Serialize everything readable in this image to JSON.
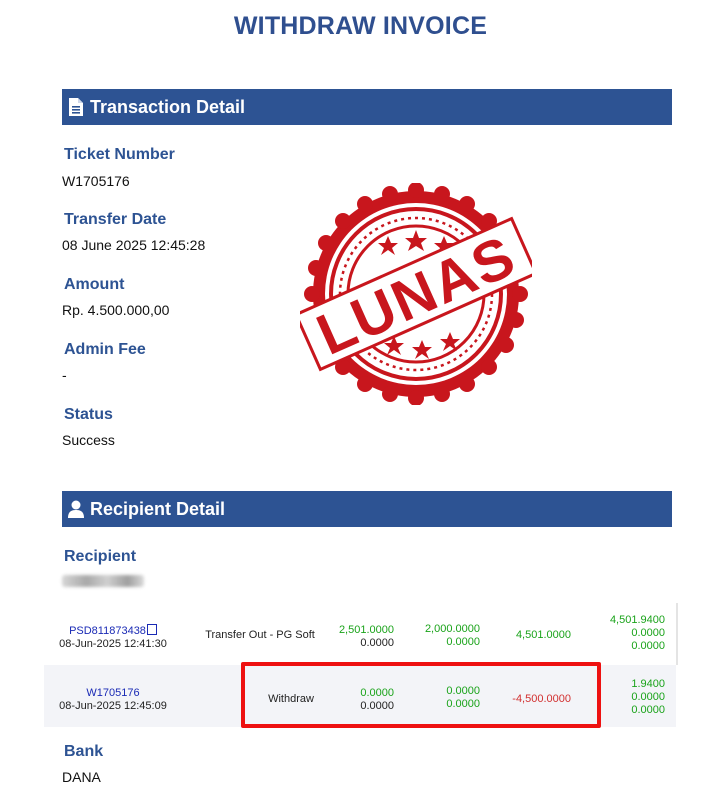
{
  "title": "WITHDRAW INVOICE",
  "transaction": {
    "heading": "Transaction Detail",
    "ticket_label": "Ticket Number",
    "ticket_value": "W1705176",
    "date_label": "Transfer Date",
    "date_value": "08 June 2025 12:45:28",
    "amount_label": "Amount",
    "amount_value": "Rp. 4.500.000,00",
    "fee_label": "Admin Fee",
    "fee_value": "-",
    "status_label": "Status",
    "status_value": "Success"
  },
  "stamp": {
    "text": "LUNAS",
    "color": "#c8161d"
  },
  "recipient": {
    "heading": "Recipient Detail",
    "label": "Recipient",
    "bank_label": "Bank",
    "bank_value": "DANA"
  },
  "table_rows": [
    {
      "id": "PSD811873438",
      "datetime": "08-Jun-2025 12:41:30",
      "description": "Transfer Out - PG Soft",
      "col1": [
        "2,501.0000",
        "0.0000"
      ],
      "col2": [
        "2,000.0000",
        "0.0000"
      ],
      "change": "4,501.0000",
      "balance": [
        "4,501.9400",
        "0.0000",
        "0.0000"
      ]
    },
    {
      "id": "W1705176",
      "datetime": "08-Jun-2025 12:45:09",
      "description": "Withdraw",
      "col1": [
        "0.0000",
        "0.0000"
      ],
      "col2": [
        "0.0000",
        "0.0000"
      ],
      "change": "-4,500.0000",
      "balance": [
        "1.9400",
        "0.0000",
        "0.0000"
      ]
    }
  ],
  "colors": {
    "accent": "#2d5393",
    "positive": "#1aa31a",
    "negative": "#d23030",
    "highlight": "#ee1111"
  }
}
